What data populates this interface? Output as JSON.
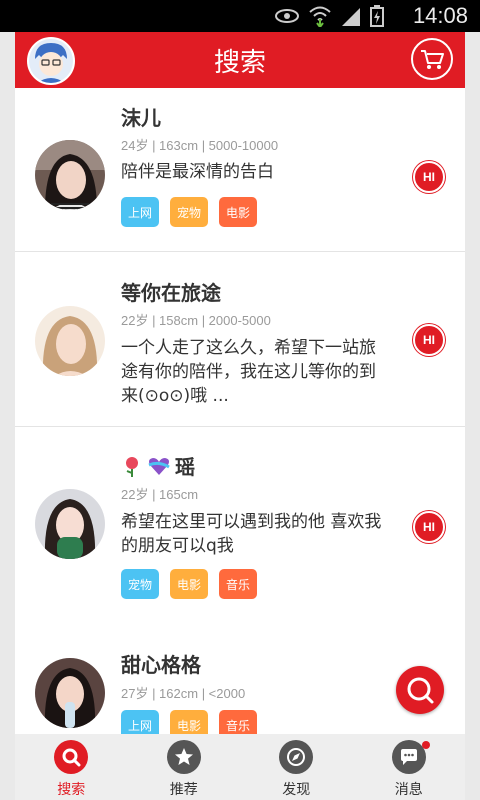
{
  "status_bar": {
    "time": "14:08"
  },
  "header": {
    "title": "搜索",
    "avatar_icon": "avatar-icon",
    "cart_icon": "cart-icon"
  },
  "users": [
    {
      "name": "沫儿",
      "meta": "24岁 | 163cm | 5000-10000",
      "message": "陪伴是最深情的告白",
      "tags": [
        "上网",
        "宠物",
        "电影"
      ],
      "hi": "HI"
    },
    {
      "name": "等你在旅途",
      "meta": "22岁 | 158cm | 2000-5000",
      "message": "一个人走了这么久，希望下一站旅途有你的陪伴，我在这儿等你的到来(⊙o⊙)哦 ...",
      "tags": [],
      "hi": "HI"
    },
    {
      "name": "瑶",
      "meta": "22岁 | 165cm",
      "message": "希望在这里可以遇到我的他  喜欢我的朋友可以q我",
      "tags": [
        "宠物",
        "电影",
        "音乐"
      ],
      "hi": "HI"
    },
    {
      "name": "甜心格格",
      "meta": "27岁 | 162cm | <2000",
      "message": "",
      "tags": [
        "上网",
        "电影",
        "音乐"
      ],
      "hi": ""
    }
  ],
  "tag_colors": {
    "上网": "#4cc3f3",
    "宠物": "#ffae3d",
    "电影": "#ff6a3d",
    "音乐": "#ff6a3d"
  },
  "bottom_nav": [
    {
      "label": "搜索",
      "icon": "search-icon",
      "active": true
    },
    {
      "label": "推荐",
      "icon": "star-icon",
      "active": false
    },
    {
      "label": "发现",
      "icon": "compass-icon",
      "active": false
    },
    {
      "label": "消息",
      "icon": "chat-icon",
      "active": false,
      "badge": true
    }
  ]
}
